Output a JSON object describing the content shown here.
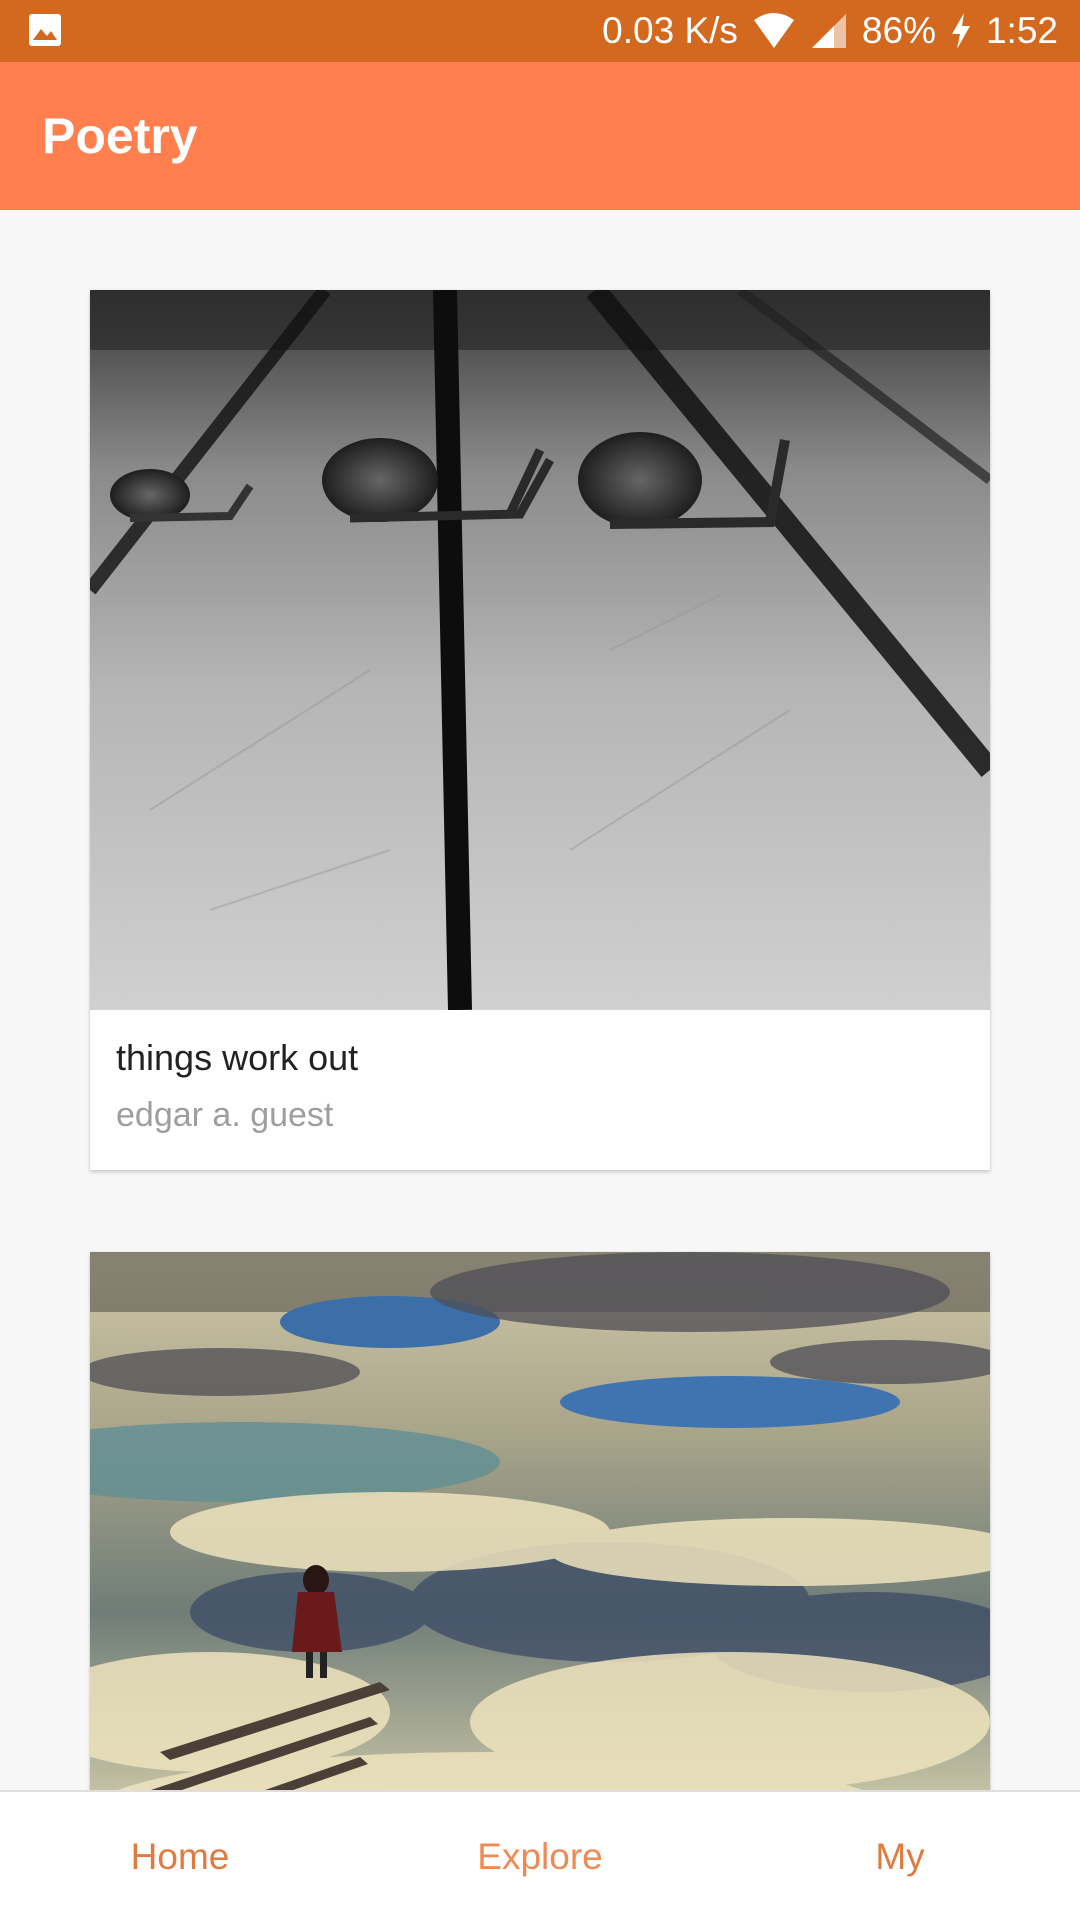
{
  "status_bar": {
    "left_icon": "gallery-notification-icon",
    "network_speed": "0.03 K/s",
    "battery": "86%",
    "time": "1:52"
  },
  "app_bar": {
    "title": "Poetry"
  },
  "poems": [
    {
      "title": "things work out",
      "author": "edgar a. guest",
      "image": "snails-on-wooden-planks"
    },
    {
      "title": "",
      "author": "",
      "image": "girl-walking-into-clouds"
    }
  ],
  "bottom_nav": {
    "tabs": [
      {
        "label": "Home"
      },
      {
        "label": "Explore"
      },
      {
        "label": "My"
      }
    ]
  },
  "colors": {
    "status_bar": "#d2691e",
    "app_bar": "#ff7f4e",
    "tab_text": "#e07a3e"
  }
}
